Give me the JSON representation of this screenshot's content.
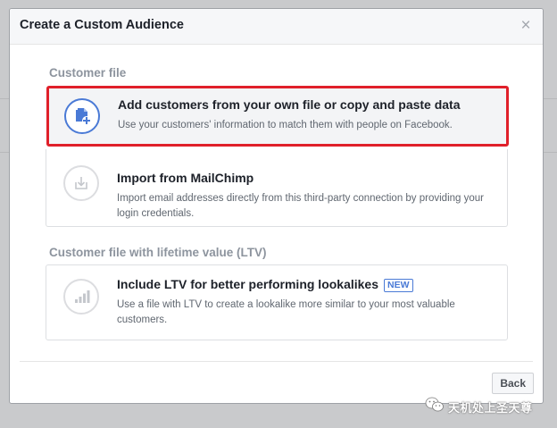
{
  "dialog": {
    "title": "Create a Custom Audience",
    "close_glyph": "×"
  },
  "sections": [
    {
      "title": "Customer file",
      "options": [
        {
          "icon": "file-add-icon",
          "title": "Add customers from your own file or copy and paste data",
          "description": "Use your customers' information to match them with people on Facebook.",
          "highlighted": true
        },
        {
          "icon": "import-icon",
          "title": "Import from MailChimp",
          "description": "Import email addresses directly from this third-party connection by providing your login credentials."
        }
      ]
    },
    {
      "title": "Customer file with lifetime value (LTV)",
      "options": [
        {
          "icon": "bar-chart-icon",
          "title": "Include LTV for better performing lookalikes",
          "badge": "NEW",
          "description": "Use a file with LTV to create a lookalike more similar to your most valuable customers."
        }
      ]
    }
  ],
  "footer": {
    "back_label": "Back"
  },
  "watermark": {
    "text": "天机处上圣天尊",
    "icon": "wechat-icon"
  },
  "colors": {
    "highlight_border": "#e0202a",
    "accent_blue": "#4a7ad6",
    "section_title": "#8d949e"
  }
}
